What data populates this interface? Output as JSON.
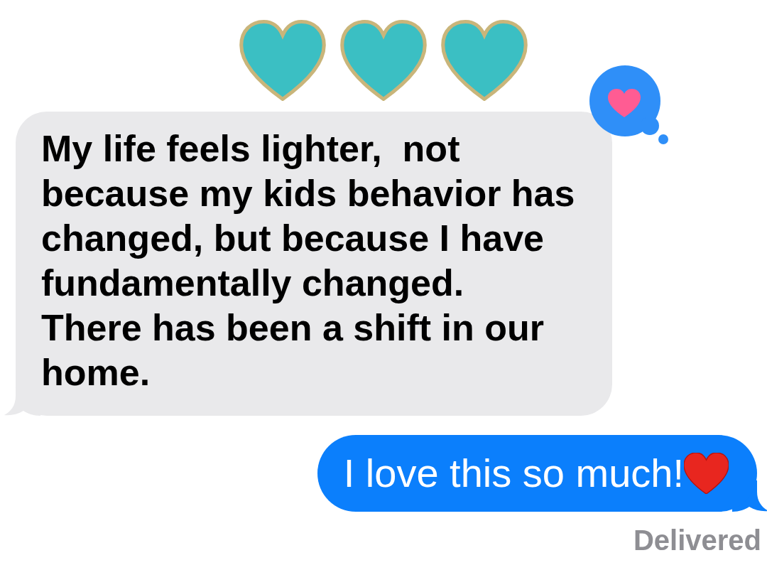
{
  "messages": [
    {
      "kind": "received",
      "text": "My life feels lighter,  not\nbecause my kids behavior has\nchanged, but because I have\nfundamentally changed.\nThere has been a shift in our\nhome.",
      "reaction": {
        "kind": "heart"
      }
    },
    {
      "kind": "sent",
      "text": "I love this so much!",
      "emoji": {
        "kind": "heart"
      }
    }
  ],
  "status": "Delivered"
}
